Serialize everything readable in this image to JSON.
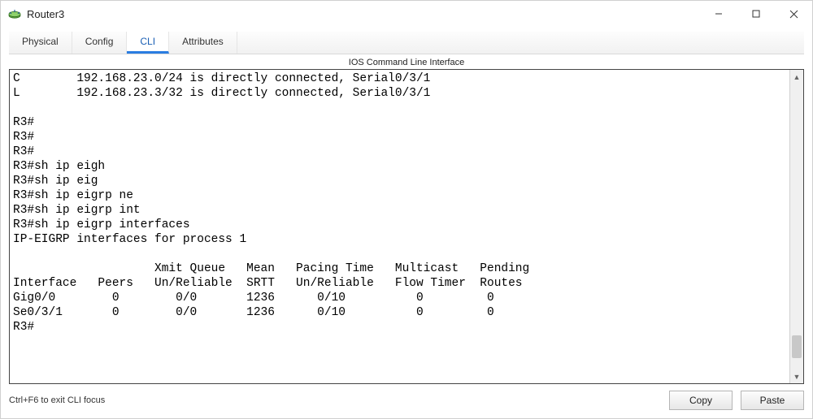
{
  "window": {
    "title": "Router3"
  },
  "tabs": {
    "physical": "Physical",
    "config": "Config",
    "cli": "CLI",
    "attributes": "Attributes"
  },
  "cli_header": "IOS Command Line Interface",
  "terminal_text": "C        192.168.23.0/24 is directly connected, Serial0/3/1\nL        192.168.23.3/32 is directly connected, Serial0/3/1\n\nR3#\nR3#\nR3#\nR3#sh ip eigh\nR3#sh ip eig\nR3#sh ip eigrp ne\nR3#sh ip eigrp int\nR3#sh ip eigrp interfaces\nIP-EIGRP interfaces for process 1\n\n                    Xmit Queue   Mean   Pacing Time   Multicast   Pending\nInterface   Peers   Un/Reliable  SRTT   Un/Reliable   Flow Timer  Routes\nGig0/0        0        0/0       1236      0/10          0         0\nSe0/3/1       0        0/0       1236      0/10          0         0\nR3#",
  "eigrp_interfaces": {
    "process": 1,
    "columns": [
      "Interface",
      "Peers",
      "Xmit Queue Un/Reliable",
      "Mean SRTT",
      "Pacing Time Un/Reliable",
      "Multicast Flow Timer",
      "Pending Routes"
    ],
    "rows": [
      {
        "interface": "Gig0/0",
        "peers": 0,
        "xmit_queue": "0/0",
        "mean_srtt": 1236,
        "pacing_time": "0/10",
        "multicast_flow_timer": 0,
        "pending_routes": 0
      },
      {
        "interface": "Se0/3/1",
        "peers": 0,
        "xmit_queue": "0/0",
        "mean_srtt": 1236,
        "pacing_time": "0/10",
        "multicast_flow_timer": 0,
        "pending_routes": 0
      }
    ]
  },
  "routes": [
    {
      "code": "C",
      "prefix": "192.168.23.0/24",
      "via": "is directly connected",
      "interface": "Serial0/3/1"
    },
    {
      "code": "L",
      "prefix": "192.168.23.3/32",
      "via": "is directly connected",
      "interface": "Serial0/3/1"
    }
  ],
  "footer": {
    "hint": "Ctrl+F6 to exit CLI focus",
    "copy": "Copy",
    "paste": "Paste"
  }
}
